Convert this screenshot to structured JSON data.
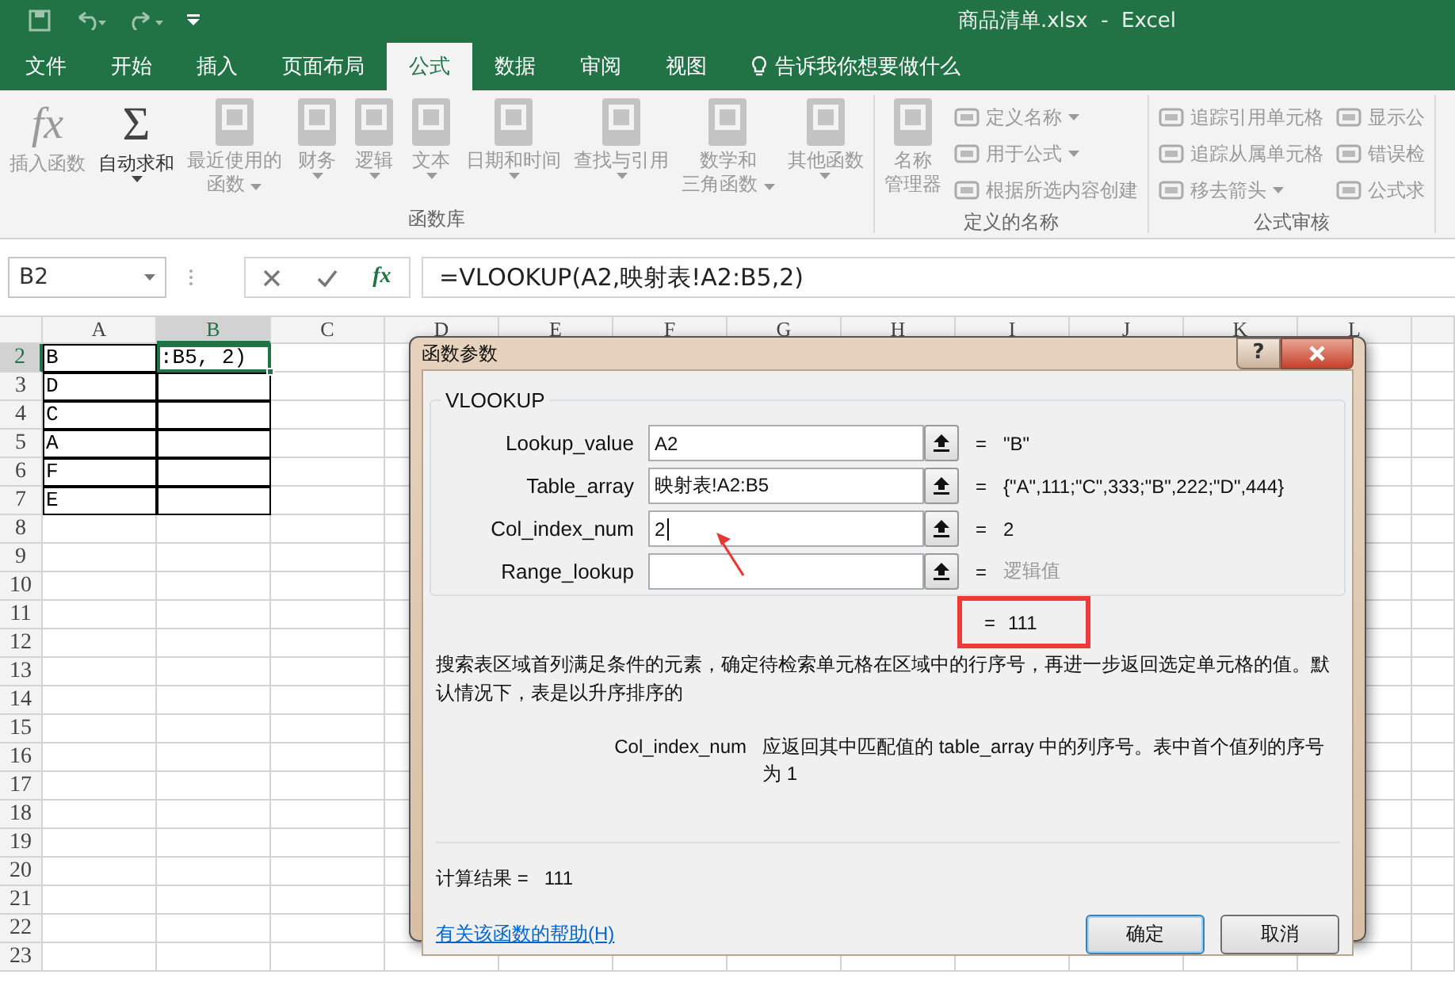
{
  "title_bar": {
    "title": "商品清单.xlsx  -  Excel"
  },
  "tabs": [
    {
      "label": "文件",
      "selected": false
    },
    {
      "label": "开始",
      "selected": false
    },
    {
      "label": "插入",
      "selected": false
    },
    {
      "label": "页面布局",
      "selected": false
    },
    {
      "label": "公式",
      "selected": true
    },
    {
      "label": "数据",
      "selected": false
    },
    {
      "label": "审阅",
      "selected": false
    },
    {
      "label": "视图",
      "selected": false
    }
  ],
  "tell_me": "告诉我你想要做什么",
  "ribbon": {
    "groups": [
      {
        "title": "函数库",
        "items": [
          {
            "kind": "large",
            "glyph": "fx",
            "label": "插入函数",
            "dropdown": false,
            "disabled": true
          },
          {
            "kind": "large",
            "glyph": "Σ",
            "label": "自动求和",
            "dropdown": true,
            "disabled": false
          },
          {
            "kind": "large",
            "label": [
              "最近使用的",
              "函数"
            ],
            "dropdown": true,
            "disabled": true
          },
          {
            "kind": "large",
            "label": "财务",
            "dropdown": true,
            "disabled": true
          },
          {
            "kind": "large",
            "label": "逻辑",
            "dropdown": true,
            "disabled": true
          },
          {
            "kind": "large",
            "label": "文本",
            "dropdown": true,
            "disabled": true
          },
          {
            "kind": "large",
            "label": "日期和时间",
            "dropdown": true,
            "disabled": true
          },
          {
            "kind": "large",
            "label": "查找与引用",
            "dropdown": true,
            "disabled": true
          },
          {
            "kind": "large",
            "label": [
              "数学和",
              "三角函数"
            ],
            "dropdown": true,
            "disabled": true
          },
          {
            "kind": "large",
            "label": "其他函数",
            "dropdown": true,
            "disabled": true
          }
        ]
      },
      {
        "title": "定义的名称",
        "items": [
          {
            "kind": "large",
            "label": [
              "名称",
              "管理器"
            ],
            "dropdown": false,
            "disabled": true
          },
          {
            "kind": "small",
            "label": "定义名称",
            "dropdown": true,
            "disabled": true
          },
          {
            "kind": "small",
            "label": "用于公式",
            "dropdown": true,
            "disabled": true
          },
          {
            "kind": "small",
            "label": "根据所选内容创建",
            "dropdown": false,
            "disabled": true
          }
        ]
      },
      {
        "title": "公式审核",
        "items": [
          {
            "kind": "small",
            "label": "追踪引用单元格",
            "dropdown": false,
            "disabled": true
          },
          {
            "kind": "small",
            "label": "追踪从属单元格",
            "dropdown": false,
            "disabled": true
          },
          {
            "kind": "small",
            "label": "移去箭头",
            "dropdown": true,
            "disabled": true
          },
          {
            "kind": "small",
            "label": "显示公",
            "dropdown": false,
            "disabled": true
          },
          {
            "kind": "small",
            "label": "错误检",
            "dropdown": false,
            "disabled": true
          },
          {
            "kind": "small",
            "label": "公式求",
            "dropdown": false,
            "disabled": true
          }
        ]
      }
    ]
  },
  "formula_bar": {
    "name_box": "B2",
    "fx": "fx",
    "formula": "=VLOOKUP(A2,映射表!A2:B5,2)"
  },
  "sheet": {
    "columns": [
      {
        "label": "A",
        "selected": false
      },
      {
        "label": "B",
        "selected": true
      },
      {
        "label": "C",
        "selected": false
      },
      {
        "label": "D",
        "selected": false
      },
      {
        "label": "E",
        "selected": false
      },
      {
        "label": "F",
        "selected": false
      },
      {
        "label": "G",
        "selected": false
      },
      {
        "label": "H",
        "selected": false
      },
      {
        "label": "I",
        "selected": false
      },
      {
        "label": "J",
        "selected": false
      },
      {
        "label": "K",
        "selected": false
      },
      {
        "label": "L",
        "selected": false
      }
    ],
    "rows": [
      {
        "label": "2",
        "selected": true,
        "cells": [
          {
            "text": "B",
            "bordered": true,
            "selected": false
          },
          {
            "text": ":B5, 2)",
            "bordered": true,
            "selected": true
          }
        ]
      },
      {
        "label": "3",
        "selected": false,
        "cells": [
          {
            "text": "D",
            "bordered": true,
            "selected": false
          },
          {
            "bordered": true,
            "selected": false
          }
        ]
      },
      {
        "label": "4",
        "selected": false,
        "cells": [
          {
            "text": "C",
            "bordered": true,
            "selected": false
          },
          {
            "bordered": true,
            "selected": false
          }
        ]
      },
      {
        "label": "5",
        "selected": false,
        "cells": [
          {
            "text": "A",
            "bordered": true,
            "selected": false
          },
          {
            "bordered": true,
            "selected": false
          }
        ]
      },
      {
        "label": "6",
        "selected": false,
        "cells": [
          {
            "text": "F",
            "bordered": true,
            "selected": false
          },
          {
            "bordered": true,
            "selected": false
          }
        ]
      },
      {
        "label": "7",
        "selected": false,
        "cells": [
          {
            "text": "E",
            "bordered": true,
            "selected": false
          },
          {
            "bordered": true,
            "selected": false
          }
        ]
      },
      {
        "label": "8",
        "selected": false
      },
      {
        "label": "9",
        "selected": false
      },
      {
        "label": "10",
        "selected": false
      },
      {
        "label": "11",
        "selected": false
      },
      {
        "label": "12",
        "selected": false
      },
      {
        "label": "13",
        "selected": false
      },
      {
        "label": "14",
        "selected": false
      },
      {
        "label": "15",
        "selected": false
      },
      {
        "label": "16",
        "selected": false
      },
      {
        "label": "17",
        "selected": false
      },
      {
        "label": "18",
        "selected": false
      },
      {
        "label": "19",
        "selected": false
      },
      {
        "label": "20",
        "selected": false
      },
      {
        "label": "21",
        "selected": false
      },
      {
        "label": "22",
        "selected": false
      },
      {
        "label": "23",
        "selected": false
      }
    ]
  },
  "dialog": {
    "title": "函数参数",
    "help": "?",
    "function_name": "VLOOKUP",
    "arguments": [
      {
        "label": "Lookup_value",
        "value": "A2",
        "equals": "=",
        "result": "\"B\"",
        "muted": false
      },
      {
        "label": "Table_array",
        "value": "映射表!A2:B5",
        "equals": "=",
        "result": "{\"A\",111;\"C\",333;\"B\",222;\"D\",444}",
        "muted": false
      },
      {
        "label": "Col_index_num",
        "value": "2",
        "equals": "=",
        "result": "2",
        "muted": false,
        "focused": true
      },
      {
        "label": "Range_lookup",
        "equals": "=",
        "result": "逻辑值",
        "muted": true
      }
    ],
    "formula_result": {
      "equals": "=",
      "value": "111"
    },
    "description": "搜索表区域首列满足条件的元素，确定待检索单元格在区域中的行序号，再进一步返回选定单元格的值。默认情况下，表是以升序排序的",
    "param_name": "Col_index_num",
    "param_description": "应返回其中匹配值的 table_array 中的列序号。表中首个值列的序号为 1",
    "result_line": "计算结果 =   111",
    "help_link": "有关该函数的帮助(H)",
    "buttons": [
      {
        "label": "确定",
        "default": true
      },
      {
        "label": "取消",
        "default": false
      }
    ]
  }
}
